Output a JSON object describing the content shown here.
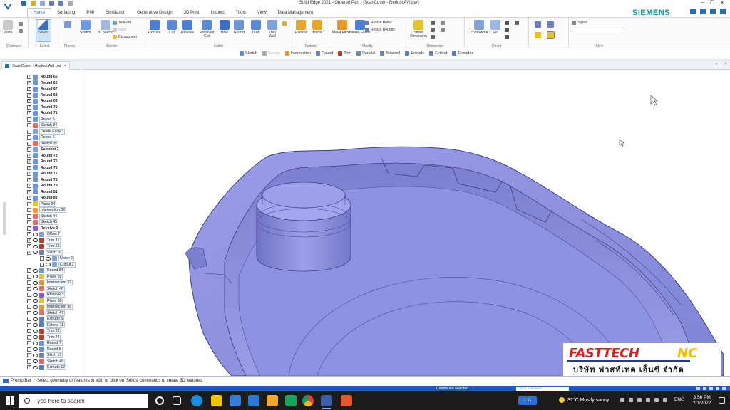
{
  "window": {
    "title": "Solid Edge 2021 - Ordered Part - [ScanCover - Reduct AVI.par]"
  },
  "brand": "SIEMENS",
  "tabs": [
    "Home",
    "Surfacing",
    "PMI",
    "Simulation",
    "Generative Design",
    "3D Print",
    "Inspect",
    "Tools",
    "View",
    "Data Management"
  ],
  "ribbon": {
    "groups": [
      "Clipboard",
      "Select",
      "Planes",
      "Sketch",
      "Solids",
      "Pattern",
      "Modify",
      "Dimension",
      "Orient",
      "Style"
    ],
    "buttons": {
      "paste": "Paste",
      "select": "Select",
      "sketch": "Sketch",
      "sketch3d": "3D Sketch",
      "extrude": "Extrude",
      "cut": "Cut",
      "revolve": "Revolve",
      "revolved_cut": "Revolved Cut",
      "hole": "Hole",
      "round": "Round",
      "draft": "Draft",
      "thin_wall": "Thin Wall",
      "pattern": "Pattern",
      "mirror": "Mirror",
      "move_faces": "Move Faces",
      "delete_faces": "Delete Faces",
      "smart_dimension": "Smart Dimension",
      "zoom_area": "Zoom Area",
      "fit": "Fit"
    },
    "small": {
      "tear_off": "Tear-Off",
      "pads": "Pads",
      "component": "Component",
      "resize_holes": "Resize Holes",
      "resize_rounds": "Resize Rounds",
      "styles": "Styles"
    }
  },
  "cmdbar": [
    "Sketch",
    "Sweep",
    "Intersection",
    "Round",
    "Trim",
    "Parallel",
    "Stitched",
    "Extrude",
    "Extend",
    "Extruded"
  ],
  "document_tab": "ScanCover - Reduct AVI.par",
  "tree": [
    {
      "label": "Round 65",
      "on": true,
      "bold": true
    },
    {
      "label": "Round 66",
      "on": true,
      "bold": true
    },
    {
      "label": "Round 67",
      "on": true,
      "bold": true
    },
    {
      "label": "Round 68",
      "on": true,
      "bold": true
    },
    {
      "label": "Round 69",
      "on": true,
      "bold": true
    },
    {
      "label": "Round 70",
      "on": true,
      "bold": true
    },
    {
      "label": "Round 71",
      "on": true,
      "bold": true
    },
    {
      "label": "Round 5",
      "on": false
    },
    {
      "label": "Sketch 34",
      "on": false
    },
    {
      "label": "Delete Face 3",
      "on": false
    },
    {
      "label": "Round 6",
      "on": false
    },
    {
      "label": "Sketch 35",
      "on": false
    },
    {
      "label": "Subtract 7",
      "on": false,
      "bold": true
    },
    {
      "label": "Round 73",
      "on": true,
      "bold": true
    },
    {
      "label": "Round 75",
      "on": true,
      "bold": true
    },
    {
      "label": "Round 76",
      "on": true,
      "bold": true
    },
    {
      "label": "Round 77",
      "on": true,
      "bold": true
    },
    {
      "label": "Round 78",
      "on": true,
      "bold": true
    },
    {
      "label": "Round 79",
      "on": true,
      "bold": true
    },
    {
      "label": "Round 81",
      "on": true,
      "bold": true
    },
    {
      "label": "Round 83",
      "on": true,
      "bold": true
    },
    {
      "label": "Plane 34",
      "on": false
    },
    {
      "label": "Intersection 36",
      "on": false
    },
    {
      "label": "Sketch 44",
      "on": false
    },
    {
      "label": "Sketch 45",
      "on": false
    },
    {
      "label": "Revolve 2",
      "on": true,
      "bold": true
    },
    {
      "label": "Offset 7",
      "on": true,
      "eye": true
    },
    {
      "label": "Trim 21",
      "on": true,
      "eye": true
    },
    {
      "label": "Trim 22",
      "on": true,
      "eye": true
    },
    {
      "label": "Stitch 16",
      "on": true,
      "eye": true
    },
    {
      "label": "Union 2",
      "on": false,
      "eye": true,
      "indent": true
    },
    {
      "label": "Cutout 2",
      "on": false,
      "eye": true,
      "indent": true
    },
    {
      "label": "Round 84",
      "on": true,
      "eye": true
    },
    {
      "label": "Plane 35",
      "on": false,
      "eye": true
    },
    {
      "label": "Intersection 37",
      "on": false,
      "eye": true
    },
    {
      "label": "Sketch 46",
      "on": false,
      "eye": true
    },
    {
      "label": "Revolve 3",
      "on": false,
      "eye": true
    },
    {
      "label": "Plane 36",
      "on": false,
      "eye": true
    },
    {
      "label": "Intersection 38",
      "on": false,
      "eye": true
    },
    {
      "label": "Sketch 47",
      "on": false,
      "eye": true
    },
    {
      "label": "Extrude 6",
      "on": false,
      "eye": true
    },
    {
      "label": "Extend 11",
      "on": false,
      "eye": true
    },
    {
      "label": "Trim 23",
      "on": false,
      "eye": true
    },
    {
      "label": "Trim 24",
      "on": false,
      "eye": true
    },
    {
      "label": "Round 7",
      "on": false,
      "eye": true
    },
    {
      "label": "Round 8",
      "on": false,
      "eye": true
    },
    {
      "label": "Stitch 17",
      "on": false,
      "eye": true
    },
    {
      "label": "Sketch 48",
      "on": false,
      "eye": true
    },
    {
      "label": "Extrude 12",
      "on": true,
      "eye": true
    }
  ],
  "promptbar": {
    "label": "PromptBar",
    "message": "Select geometry or features to edit, or click on 'Solids' commands to create 3D features."
  },
  "status": {
    "selection": "0 items are selected",
    "find": "Find a command"
  },
  "taskbar": {
    "search_placeholder": "Type here to search",
    "pill": "1:11",
    "weather": "32°C  Mostly sunny",
    "lang": "ENG",
    "time": "3:56 PM",
    "date": "2/1/2022"
  },
  "logo": {
    "brand_left": "FASTTECH",
    "brand_right": "NC",
    "thai": "บริษัท ฟาสท์เทค เอ็นซี จำกัด"
  },
  "colors": {
    "model": "#8b8fe0",
    "model_dark": "#6b6fc4",
    "accent": "#1e5bb8",
    "siemens": "#009999"
  }
}
